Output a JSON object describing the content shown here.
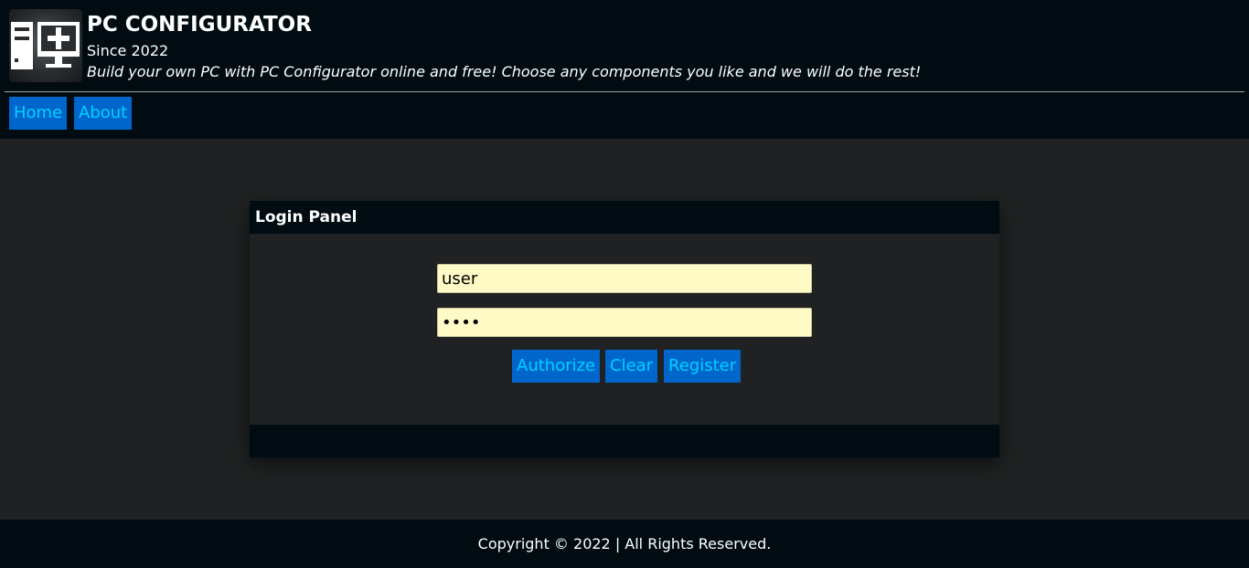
{
  "header": {
    "title": "PC CONFIGURATOR",
    "since": "Since 2022",
    "tagline": "Build your own PC with PC Configurator online and free! Choose any components you like and we will do the rest!",
    "logo_icon": "pc-monitor-plus-icon"
  },
  "nav": {
    "items": [
      {
        "label": "Home"
      },
      {
        "label": "About"
      }
    ]
  },
  "login": {
    "title": "Login Panel",
    "username_value": "user",
    "password_value": "••••",
    "authorize_label": "Authorize",
    "clear_label": "Clear",
    "register_label": "Register"
  },
  "footer": {
    "copyright": "Copyright © 2022 | All Rights Reserved."
  },
  "colors": {
    "page_bg": "#1f2122",
    "bar_bg": "#000c12",
    "button_bg": "#0066cc",
    "button_text": "#00d2ff",
    "input_bg": "#fffac6"
  }
}
